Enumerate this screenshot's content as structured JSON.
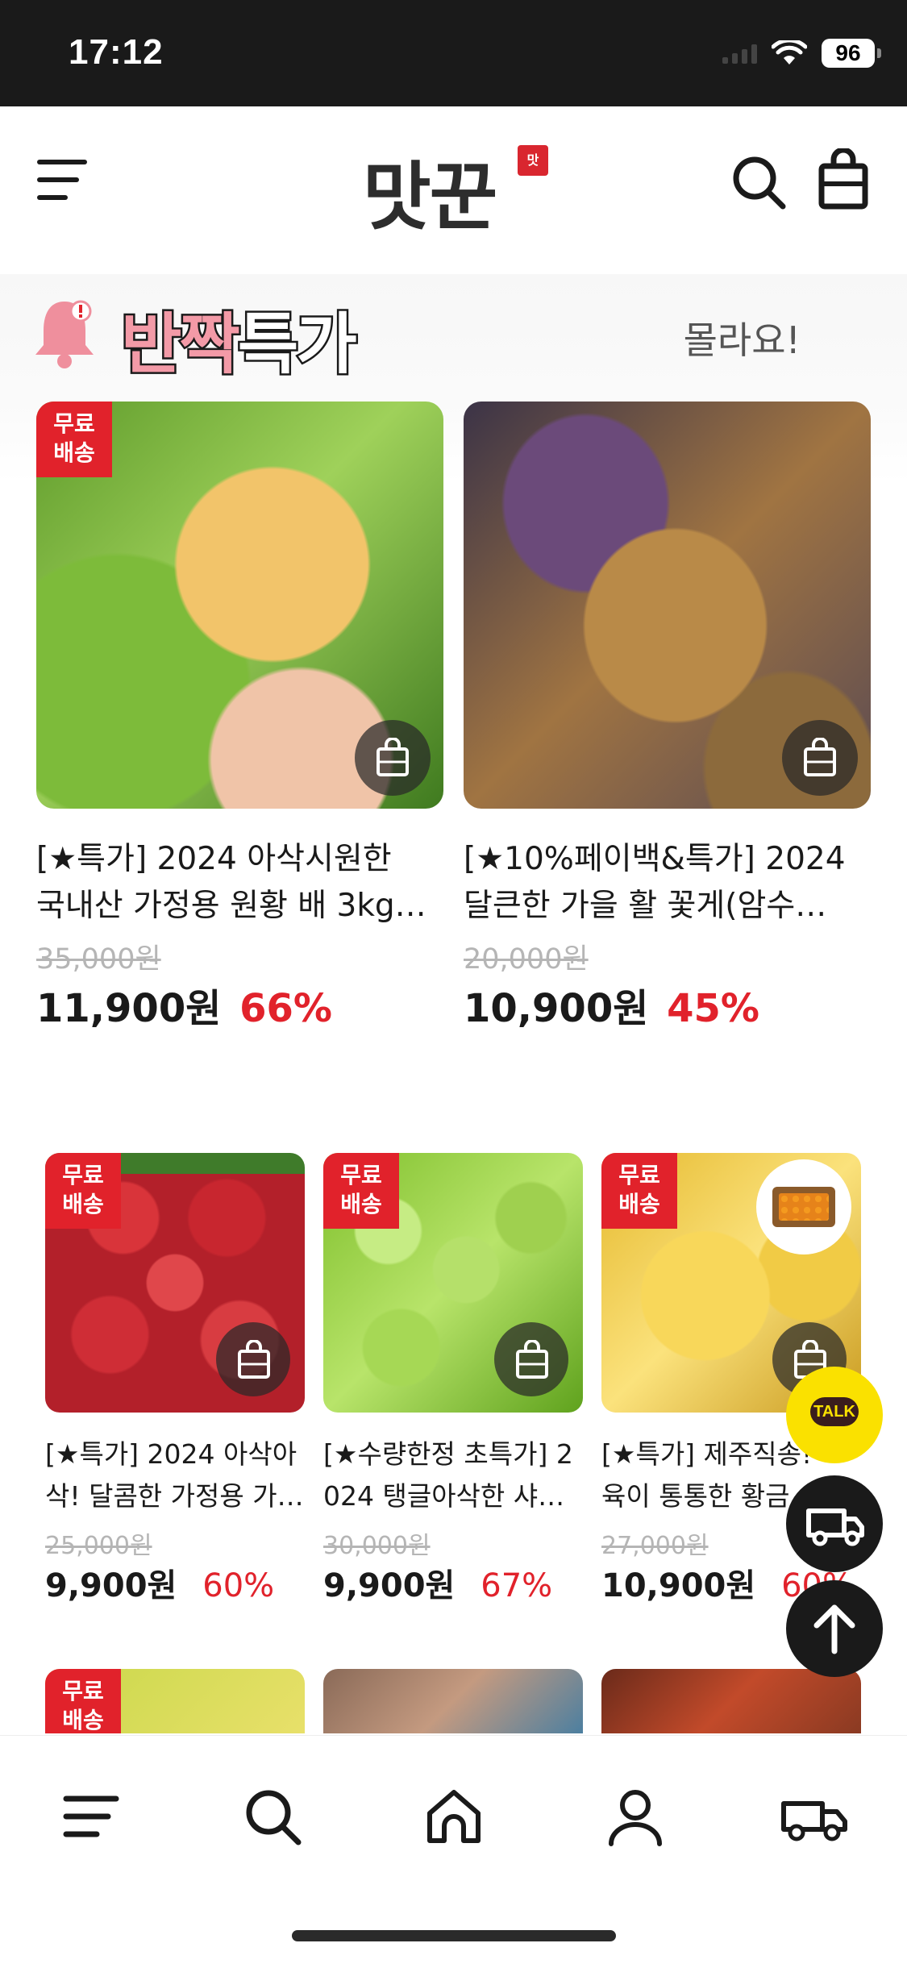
{
  "status_bar": {
    "time": "17:12",
    "battery": "96"
  },
  "header": {
    "logo": "맛꾼",
    "logo_seal": "맛"
  },
  "section": {
    "title_highlight": "반짝",
    "title_rest": "특가",
    "link": "몰라요!"
  },
  "badge_text": {
    "line1": "무료",
    "line2": "배송"
  },
  "featured_products": [
    {
      "name_line1": "[★특가] 2024 아삭시원한",
      "name_line2": "국내산 가정용 원황 배 3kg…",
      "original_price": "35,000원",
      "price": "11,900원",
      "discount": "66%",
      "free_shipping": true
    },
    {
      "name_line1": "[★10%페이백&특가] 2024",
      "name_line2": "달큰한 가을 활 꽃게(암수…",
      "original_price": "20,000원",
      "price": "10,900원",
      "discount": "45%",
      "free_shipping": false
    }
  ],
  "products": [
    {
      "name_line1": "[★특가] 2024 아삭아",
      "name_line2": "삭! 달콤한 가정용 가…",
      "original_price": "25,000원",
      "price": "9,900원",
      "discount": "60%",
      "free_shipping": true
    },
    {
      "name_line1": "[★수량한정 초특가] 2",
      "name_line2": "024 탱글아삭한 샤…",
      "original_price": "30,000원",
      "price": "9,900원",
      "discount": "67%",
      "free_shipping": true
    },
    {
      "name_line1": "[★특가] 제주직송!",
      "name_line2": "육이 통통한 황금…",
      "original_price": "27,000원",
      "price": "10,900원",
      "discount": "60%",
      "free_shipping": true
    }
  ],
  "floating": {
    "talk": "TALK"
  },
  "colors": {
    "accent_red": "#e1222b",
    "kakao_yellow": "#fae100",
    "dark": "#1a1a1a",
    "pink": "#f39aa7"
  },
  "bottom_nav": [
    "menu-icon",
    "search-icon",
    "home-icon",
    "profile-icon",
    "delivery-truck-icon"
  ]
}
